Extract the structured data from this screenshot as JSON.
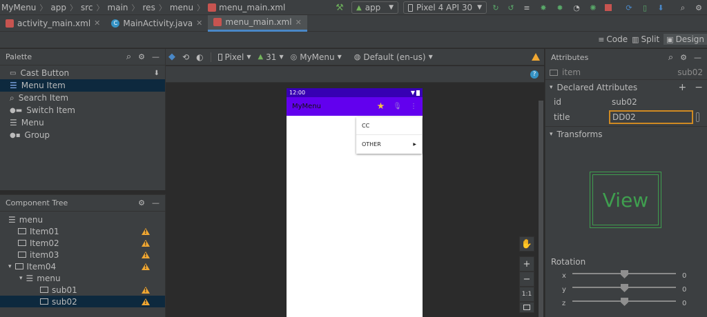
{
  "breadcrumb": {
    "items": [
      "MyMenu",
      "app",
      "src",
      "main",
      "res",
      "menu",
      "menu_main.xml"
    ]
  },
  "toolbar": {
    "run_config": "app",
    "device": "Pixel 4 API 30"
  },
  "tabs": [
    {
      "label": "activity_main.xml",
      "icon": "xml-file-icon"
    },
    {
      "label": "MainActivity.java",
      "icon": "java-class-icon"
    },
    {
      "label": "menu_main.xml",
      "icon": "xml-file-icon",
      "active": true
    }
  ],
  "view_modes": {
    "code": "Code",
    "split": "Split",
    "design": "Design"
  },
  "palette": {
    "title": "Palette",
    "items": [
      {
        "label": "Cast Button",
        "icon": "cast-icon"
      },
      {
        "label": "Menu Item",
        "icon": "menu-item-icon",
        "selected": true
      },
      {
        "label": "Search Item",
        "icon": "search-icon"
      },
      {
        "label": "Switch Item",
        "icon": "switch-icon"
      },
      {
        "label": "Menu",
        "icon": "menu-icon"
      },
      {
        "label": "Group",
        "icon": "group-icon"
      }
    ]
  },
  "component_tree": {
    "title": "Component Tree",
    "items": [
      {
        "label": "menu",
        "level": 0,
        "warning": false
      },
      {
        "label": "Item01",
        "level": 1,
        "warning": true
      },
      {
        "label": "Item02",
        "level": 1,
        "warning": true
      },
      {
        "label": "item03",
        "level": 1,
        "warning": true
      },
      {
        "label": "Item04",
        "level": 1,
        "warning": true,
        "expanded": true
      },
      {
        "label": "menu",
        "level": 2,
        "warning": false
      },
      {
        "label": "sub01",
        "level": 3,
        "warning": true
      },
      {
        "label": "sub02",
        "level": 3,
        "warning": true,
        "selected": true
      }
    ]
  },
  "design_toolbar": {
    "device": "Pixel",
    "api": "31",
    "theme": "MyMenu",
    "locale": "Default (en-us)"
  },
  "phone": {
    "time": "12:00",
    "app_title": "MyMenu",
    "popup_items": [
      "CC",
      "OTHER"
    ]
  },
  "zoom": {
    "one_to_one": "1:1"
  },
  "attributes": {
    "title": "Attributes",
    "component_type": "item",
    "component_id": "sub02",
    "declared_section": "Declared Attributes",
    "declared": [
      {
        "key": "id",
        "value": "sub02"
      },
      {
        "key": "title",
        "value": "DD02"
      }
    ],
    "transforms_section": "Transforms",
    "preview_label": "View",
    "rotation_label": "Rotation",
    "rotation": [
      {
        "axis": "x",
        "value": "0"
      },
      {
        "axis": "y",
        "value": "0"
      },
      {
        "axis": "z",
        "value": "0"
      }
    ]
  },
  "colors": {
    "accent": "#4a88c7",
    "warning": "#f0a732",
    "status_bar": "#3700b3",
    "app_bar": "#6200ee",
    "selection": "#0d293e",
    "preview_green": "#3f9f4f",
    "focus_border": "#d08a22"
  }
}
